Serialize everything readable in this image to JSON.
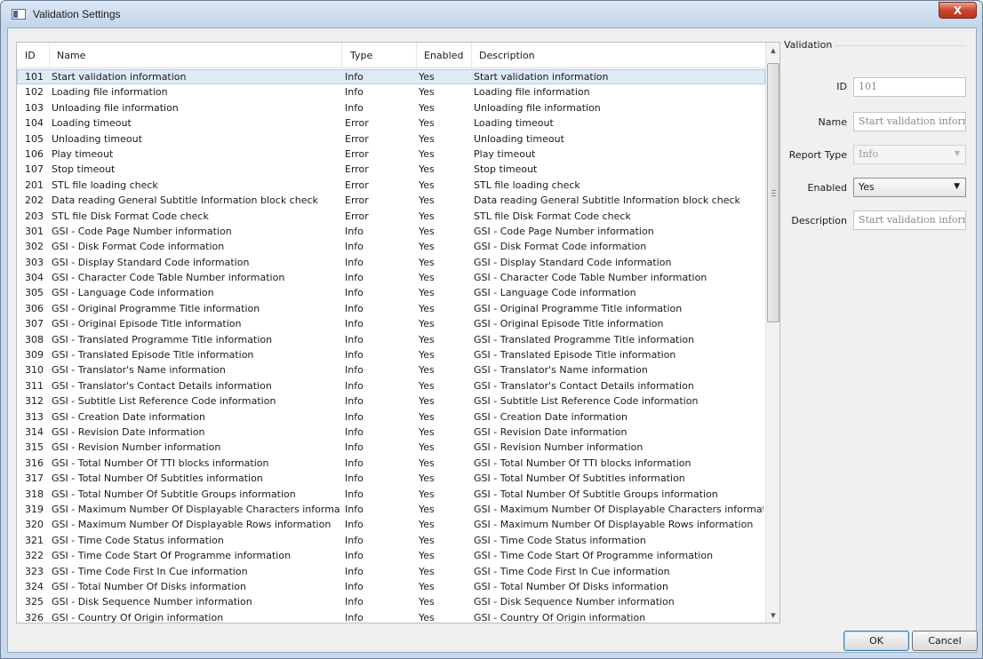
{
  "window": {
    "title": "Validation Settings",
    "close_label": "X"
  },
  "table": {
    "columns": [
      "ID",
      "Name",
      "Type",
      "Enabled",
      "Description"
    ],
    "selected_row": 0,
    "rows": [
      [
        "101",
        "Start validation information",
        "Info",
        "Yes",
        "Start validation information"
      ],
      [
        "102",
        "Loading file information",
        "Info",
        "Yes",
        "Loading file information"
      ],
      [
        "103",
        "Unloading file information",
        "Info",
        "Yes",
        "Unloading file information"
      ],
      [
        "104",
        "Loading timeout",
        "Error",
        "Yes",
        "Loading timeout"
      ],
      [
        "105",
        "Unloading timeout",
        "Error",
        "Yes",
        "Unloading timeout"
      ],
      [
        "106",
        "Play timeout",
        "Error",
        "Yes",
        "Play timeout"
      ],
      [
        "107",
        "Stop timeout",
        "Error",
        "Yes",
        "Stop timeout"
      ],
      [
        "201",
        "STL file loading check",
        "Error",
        "Yes",
        "STL file loading check"
      ],
      [
        "202",
        "Data reading General Subtitle Information block check",
        "Error",
        "Yes",
        "Data reading General Subtitle Information block check"
      ],
      [
        "203",
        "STL file Disk Format Code check",
        "Error",
        "Yes",
        "STL file Disk Format Code check"
      ],
      [
        "301",
        "GSI - Code Page Number information",
        "Info",
        "Yes",
        "GSI - Code Page Number information"
      ],
      [
        "302",
        "GSI - Disk Format Code information",
        "Info",
        "Yes",
        "GSI - Disk Format Code information"
      ],
      [
        "303",
        "GSI - Display Standard Code information",
        "Info",
        "Yes",
        "GSI - Display Standard Code information"
      ],
      [
        "304",
        "GSI - Character Code Table Number information",
        "Info",
        "Yes",
        "GSI - Character Code Table Number information"
      ],
      [
        "305",
        "GSI - Language Code information",
        "Info",
        "Yes",
        "GSI - Language Code information"
      ],
      [
        "306",
        "GSI - Original Programme Title information",
        "Info",
        "Yes",
        "GSI - Original Programme Title information"
      ],
      [
        "307",
        "GSI - Original Episode Title information",
        "Info",
        "Yes",
        "GSI - Original Episode Title information"
      ],
      [
        "308",
        "GSI - Translated Programme Title information",
        "Info",
        "Yes",
        "GSI - Translated Programme Title information"
      ],
      [
        "309",
        "GSI - Translated Episode Title information",
        "Info",
        "Yes",
        "GSI - Translated Episode Title information"
      ],
      [
        "310",
        "GSI - Translator's Name information",
        "Info",
        "Yes",
        "GSI - Translator's Name information"
      ],
      [
        "311",
        "GSI - Translator's Contact Details information",
        "Info",
        "Yes",
        "GSI - Translator's Contact Details information"
      ],
      [
        "312",
        "GSI - Subtitle List Reference Code information",
        "Info",
        "Yes",
        "GSI - Subtitle List Reference Code information"
      ],
      [
        "313",
        "GSI - Creation Date information",
        "Info",
        "Yes",
        "GSI - Creation Date information"
      ],
      [
        "314",
        "GSI - Revision Date information",
        "Info",
        "Yes",
        "GSI - Revision Date information"
      ],
      [
        "315",
        "GSI - Revision Number information",
        "Info",
        "Yes",
        "GSI - Revision Number information"
      ],
      [
        "316",
        "GSI - Total Number Of TTI blocks information",
        "Info",
        "Yes",
        "GSI - Total Number Of TTI blocks information"
      ],
      [
        "317",
        "GSI - Total Number Of Subtitles information",
        "Info",
        "Yes",
        "GSI - Total Number Of Subtitles information"
      ],
      [
        "318",
        "GSI - Total Number Of Subtitle Groups information",
        "Info",
        "Yes",
        "GSI - Total Number Of Subtitle Groups information"
      ],
      [
        "319",
        "GSI - Maximum Number Of Displayable Characters information",
        "Info",
        "Yes",
        "GSI - Maximum Number Of Displayable Characters information"
      ],
      [
        "320",
        "GSI - Maximum Number Of Displayable Rows information",
        "Info",
        "Yes",
        "GSI - Maximum Number Of Displayable Rows information"
      ],
      [
        "321",
        "GSI - Time Code Status information",
        "Info",
        "Yes",
        "GSI - Time Code Status information"
      ],
      [
        "322",
        "GSI - Time Code Start Of Programme information",
        "Info",
        "Yes",
        "GSI - Time Code Start Of Programme information"
      ],
      [
        "323",
        "GSI - Time Code First In Cue information",
        "Info",
        "Yes",
        "GSI - Time Code First In Cue information"
      ],
      [
        "324",
        "GSI - Total Number Of Disks information",
        "Info",
        "Yes",
        "GSI - Total Number Of Disks information"
      ],
      [
        "325",
        "GSI - Disk Sequence Number information",
        "Info",
        "Yes",
        "GSI - Disk Sequence Number information"
      ],
      [
        "326",
        "GSI - Country Of Origin information",
        "Info",
        "Yes",
        "GSI - Country Of Origin information"
      ]
    ]
  },
  "panel": {
    "title": "Validation",
    "id_label": "ID",
    "id_value": "101",
    "name_label": "Name",
    "name_value": "Start validation informat",
    "report_type_label": "Report Type",
    "report_type_value": "Info",
    "enabled_label": "Enabled",
    "enabled_value": "Yes",
    "description_label": "Description",
    "description_value": "Start validation informat"
  },
  "buttons": {
    "ok": "OK",
    "cancel": "Cancel"
  },
  "icons": {
    "app": "window-app-icon",
    "close": "close-icon",
    "scroll_up": "scroll-up-icon",
    "scroll_down": "scroll-down-icon",
    "dropdown": "chevron-down-icon"
  }
}
